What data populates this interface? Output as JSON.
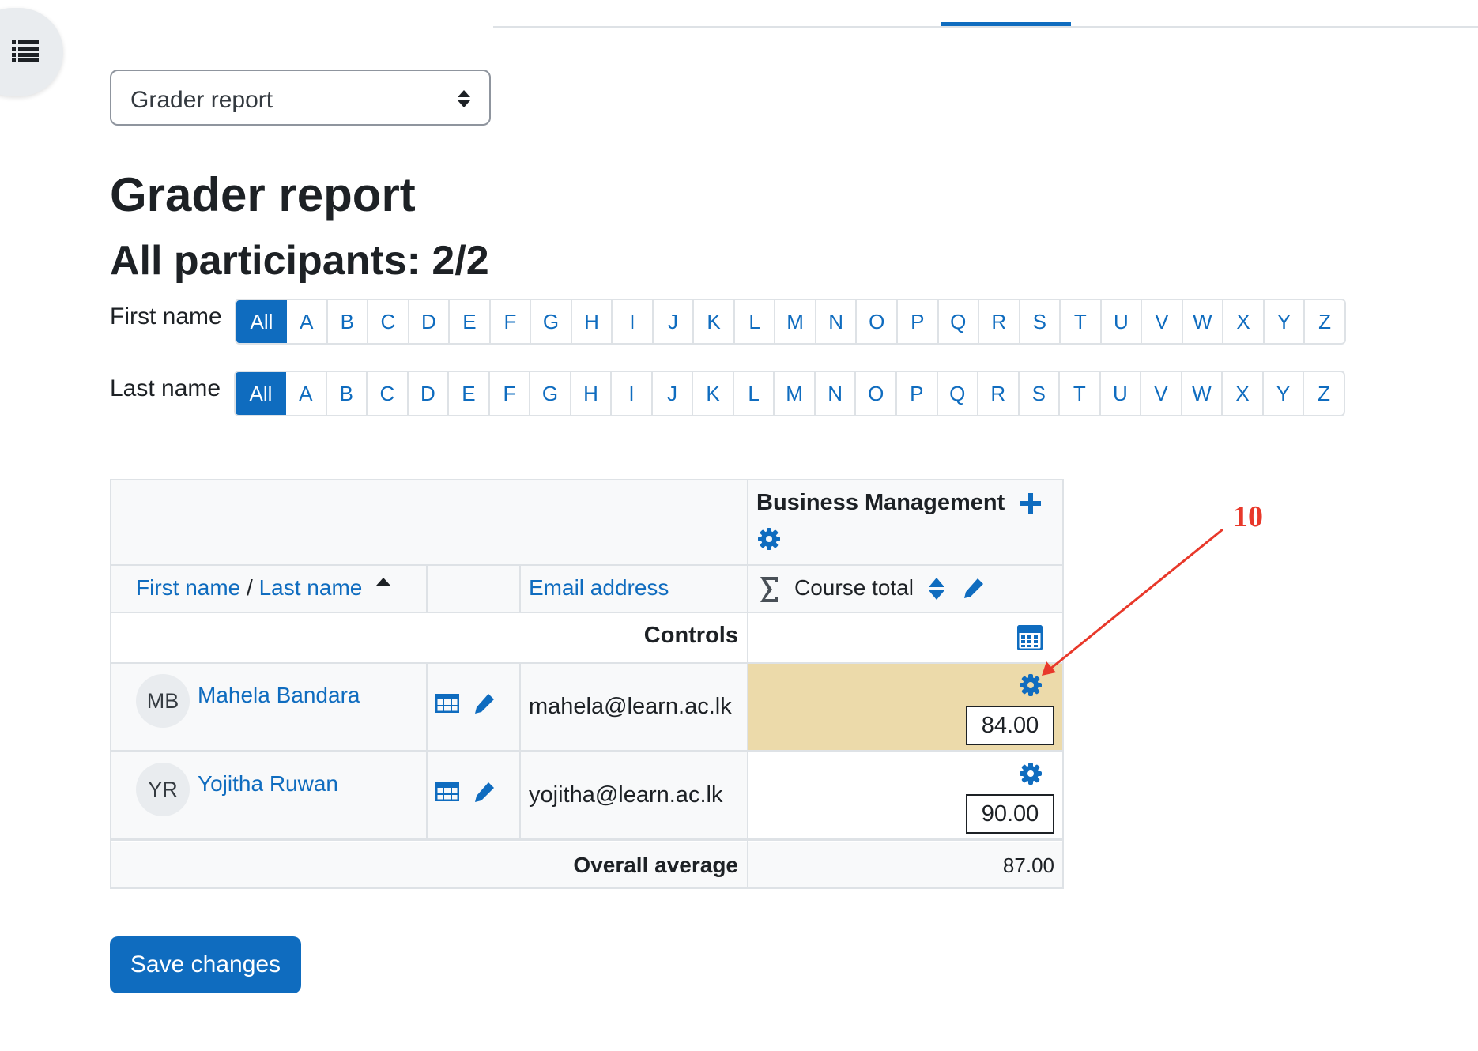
{
  "top_nav": {
    "drawer_icon": "list-icon"
  },
  "report_select": {
    "value": "Grader report",
    "icon": "sort-arrows-icon"
  },
  "page_title": "Grader report",
  "participants": "All participants: 2/2",
  "initials_bar": {
    "letters": [
      "All",
      "A",
      "B",
      "C",
      "D",
      "E",
      "F",
      "G",
      "H",
      "I",
      "J",
      "K",
      "L",
      "M",
      "N",
      "O",
      "P",
      "Q",
      "R",
      "S",
      "T",
      "U",
      "V",
      "W",
      "X",
      "Y",
      "Z"
    ],
    "first_name": {
      "label": "First name",
      "selected": "All"
    },
    "last_name": {
      "label": "Last name",
      "selected": "All"
    }
  },
  "grader_table": {
    "category_name": "Business Management",
    "expand_icon": "plus-icon",
    "settings_icon": "gear-icon",
    "headers": {
      "first_name": "First name",
      "separator": "/",
      "last_name": "Last name",
      "sort_icon": "caret-up-icon",
      "email": "Email address",
      "course_total": "Course total",
      "course_total_icon": "sigma-icon"
    },
    "controls_label": "Controls",
    "calculator_icon": "calculator-icon",
    "rows": [
      {
        "initials": "MB",
        "name": "Mahela Bandara",
        "email": "mahela@learn.ac.lk",
        "grade": "84.00",
        "highlighted": true
      },
      {
        "initials": "YR",
        "name": "Yojitha Ruwan",
        "email": "yojitha@learn.ac.lk",
        "grade": "90.00",
        "highlighted": false
      }
    ],
    "overall_average_label": "Overall average",
    "overall_average_value": "87.00"
  },
  "save_button": "Save changes",
  "annotation": {
    "number": "10",
    "color": "#e8382a"
  },
  "colors": {
    "primary": "#0f6cbf",
    "highlight": "#ecdaaa",
    "header_bg": "#f8f9fa",
    "border": "#dee2e6"
  }
}
